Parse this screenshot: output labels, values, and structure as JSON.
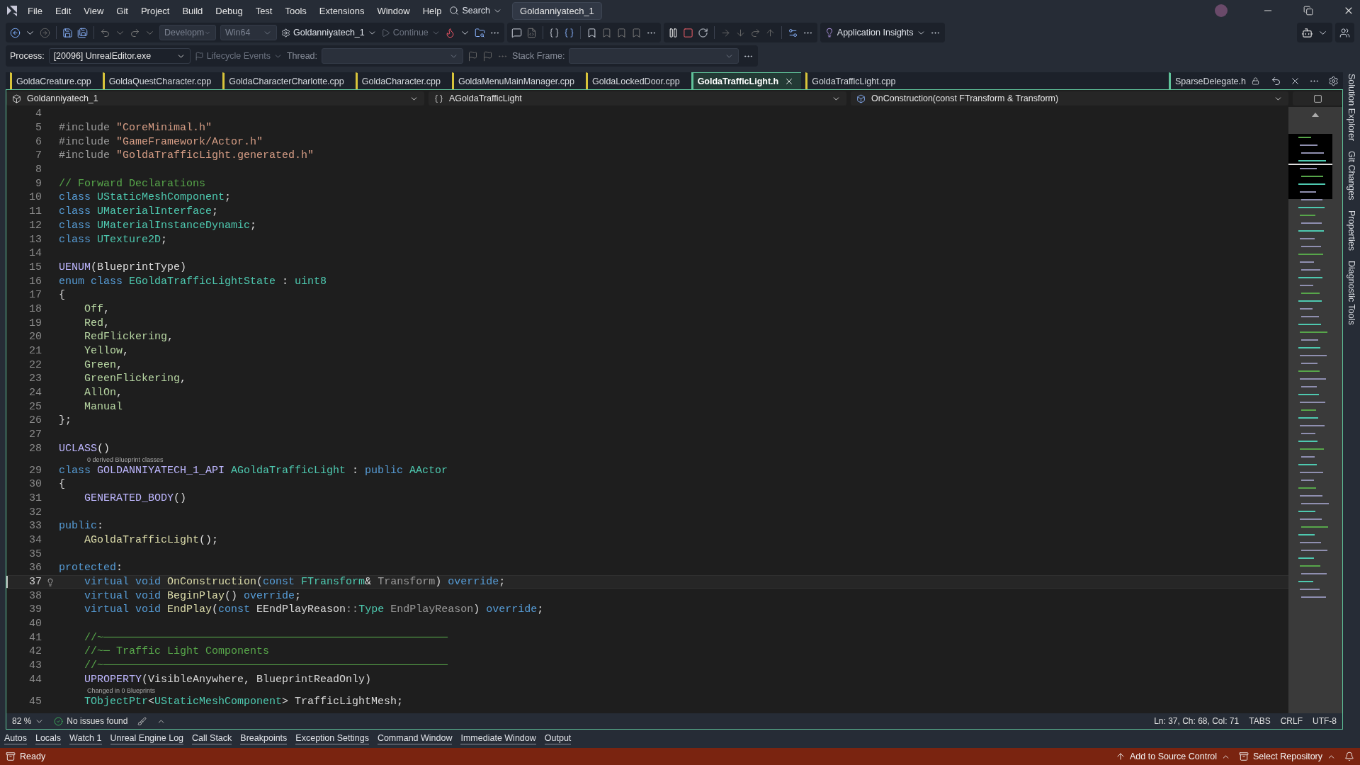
{
  "menu": [
    "File",
    "Edit",
    "View",
    "Git",
    "Project",
    "Build",
    "Debug",
    "Test",
    "Tools",
    "Extensions",
    "Window",
    "Help"
  ],
  "search": "Search",
  "solution_title": "Goldanniyatech_1",
  "toolbar": {
    "configuration": "Developm",
    "platform": "Win64",
    "startup": "Goldanniyatech_1",
    "continue": "Continue",
    "insights": "Application Insights"
  },
  "debug_bar": {
    "process_label": "Process:",
    "process": "[20096] UnrealEditor.exe",
    "lifecycle": "Lifecycle Events",
    "thread_label": "Thread:",
    "stack_label": "Stack Frame:"
  },
  "tabs": [
    {
      "label": "GoldaCreature.cpp",
      "color": "#d8c43a",
      "selected": false
    },
    {
      "label": "GoldaQuestCharacter.cpp",
      "color": "#d8c43a",
      "selected": false
    },
    {
      "label": "GoldaCharacterCharlotte.cpp",
      "color": "#d8c43a",
      "selected": false
    },
    {
      "label": "GoldaCharacter.cpp",
      "color": "#d8c43a",
      "selected": false
    },
    {
      "label": "GoldaMenuMainManager.cpp",
      "color": "#d8c43a",
      "selected": false
    },
    {
      "label": "GoldaLockedDoor.cpp",
      "color": "#d8c43a",
      "selected": false
    },
    {
      "label": "GoldaTrafficLight.h",
      "color": "#5fc39a",
      "selected": true
    },
    {
      "label": "GoldaTrafficLight.cpp",
      "color": "#d8c43a",
      "selected": false
    }
  ],
  "pinned_tab": {
    "label": "SparseDelegate.h",
    "color": "#5fc39a"
  },
  "nav": {
    "project": "Goldanniyatech_1",
    "scope": "AGoldaTrafficLight",
    "member": "OnConstruction(const FTransform & Transform)"
  },
  "lines": [
    {
      "kind": "code",
      "num": "4",
      "selected": false
    },
    {
      "kind": "code",
      "num": "5",
      "selected": false,
      "tokens": [
        {
          "text": "#include ",
          "kind": "pre"
        },
        {
          "text": "\"CoreMinimal.h\"",
          "kind": "str"
        }
      ]
    },
    {
      "kind": "code",
      "num": "6",
      "selected": false,
      "tokens": [
        {
          "text": "#include ",
          "kind": "pre"
        },
        {
          "text": "\"GameFramework/Actor.h\"",
          "kind": "str"
        }
      ]
    },
    {
      "kind": "code",
      "num": "7",
      "selected": false,
      "tokens": [
        {
          "text": "#include ",
          "kind": "pre"
        },
        {
          "text": "\"GoldaTrafficLight.generated.h\"",
          "kind": "str"
        }
      ]
    },
    {
      "kind": "code",
      "num": "8",
      "selected": false
    },
    {
      "kind": "code",
      "num": "9",
      "selected": false,
      "tokens": [
        {
          "text": "// Forward Declarations",
          "kind": "cm"
        }
      ]
    },
    {
      "kind": "code",
      "num": "10",
      "selected": false,
      "tokens": [
        {
          "text": "class ",
          "kind": "kw"
        },
        {
          "text": "UStaticMeshComponent",
          "kind": "type"
        },
        {
          "text": ";",
          "kind": "plain"
        }
      ]
    },
    {
      "kind": "code",
      "num": "11",
      "selected": false,
      "tokens": [
        {
          "text": "class ",
          "kind": "kw"
        },
        {
          "text": "UMaterialInterface",
          "kind": "type"
        },
        {
          "text": ";",
          "kind": "plain"
        }
      ]
    },
    {
      "kind": "code",
      "num": "12",
      "selected": false,
      "tokens": [
        {
          "text": "class ",
          "kind": "kw"
        },
        {
          "text": "UMaterialInstanceDynamic",
          "kind": "type"
        },
        {
          "text": ";",
          "kind": "plain"
        }
      ]
    },
    {
      "kind": "code",
      "num": "13",
      "selected": false,
      "tokens": [
        {
          "text": "class ",
          "kind": "kw"
        },
        {
          "text": "UTexture2D",
          "kind": "type"
        },
        {
          "text": ";",
          "kind": "plain"
        }
      ]
    },
    {
      "kind": "code",
      "num": "14",
      "selected": false
    },
    {
      "kind": "code",
      "num": "15",
      "selected": false,
      "tokens": [
        {
          "text": "UENUM",
          "kind": "mac"
        },
        {
          "text": "(BlueprintType)",
          "kind": "plain"
        }
      ]
    },
    {
      "kind": "code",
      "num": "16",
      "selected": false,
      "tokens": [
        {
          "text": "enum class ",
          "kind": "kw"
        },
        {
          "text": "EGoldaTrafficLightState",
          "kind": "type"
        },
        {
          "text": " : ",
          "kind": "plain"
        },
        {
          "text": "uint8",
          "kind": "type"
        }
      ]
    },
    {
      "kind": "code",
      "num": "17",
      "selected": false,
      "tokens": [
        {
          "text": "{",
          "kind": "plain"
        }
      ]
    },
    {
      "kind": "code",
      "num": "18",
      "selected": false,
      "tokens": [
        {
          "text": "    Off",
          "kind": "enum"
        },
        {
          "text": ",",
          "kind": "plain"
        }
      ]
    },
    {
      "kind": "code",
      "num": "19",
      "selected": false,
      "tokens": [
        {
          "text": "    Red",
          "kind": "enum"
        },
        {
          "text": ",",
          "kind": "plain"
        }
      ]
    },
    {
      "kind": "code",
      "num": "20",
      "selected": false,
      "tokens": [
        {
          "text": "    RedFlickering",
          "kind": "enum"
        },
        {
          "text": ",",
          "kind": "plain"
        }
      ]
    },
    {
      "kind": "code",
      "num": "21",
      "selected": false,
      "tokens": [
        {
          "text": "    Yellow",
          "kind": "enum"
        },
        {
          "text": ",",
          "kind": "plain"
        }
      ]
    },
    {
      "kind": "code",
      "num": "22",
      "selected": false,
      "tokens": [
        {
          "text": "    Green",
          "kind": "enum"
        },
        {
          "text": ",",
          "kind": "plain"
        }
      ]
    },
    {
      "kind": "code",
      "num": "23",
      "selected": false,
      "tokens": [
        {
          "text": "    GreenFlickering",
          "kind": "enum"
        },
        {
          "text": ",",
          "kind": "plain"
        }
      ]
    },
    {
      "kind": "code",
      "num": "24",
      "selected": false,
      "tokens": [
        {
          "text": "    AllOn",
          "kind": "enum"
        },
        {
          "text": ",",
          "kind": "plain"
        }
      ]
    },
    {
      "kind": "code",
      "num": "25",
      "selected": false,
      "tokens": [
        {
          "text": "    Manual",
          "kind": "enum"
        }
      ]
    },
    {
      "kind": "code",
      "num": "26",
      "selected": false,
      "tokens": [
        {
          "text": "};",
          "kind": "plain"
        }
      ]
    },
    {
      "kind": "code",
      "num": "27",
      "selected": false
    },
    {
      "kind": "code",
      "num": "28",
      "selected": false,
      "tokens": [
        {
          "text": "UCLASS",
          "kind": "mac"
        },
        {
          "text": "()",
          "kind": "plain"
        }
      ]
    },
    {
      "kind": "lens",
      "text": "0 derived Blueprint classes"
    },
    {
      "kind": "code",
      "num": "29",
      "selected": false,
      "tokens": [
        {
          "text": "class ",
          "kind": "kw"
        },
        {
          "text": "GOLDANNIYATECH_1_API ",
          "kind": "mac"
        },
        {
          "text": "AGoldaTrafficLight",
          "kind": "type"
        },
        {
          "text": " : ",
          "kind": "plain"
        },
        {
          "text": "public ",
          "kind": "kw"
        },
        {
          "text": "AActor",
          "kind": "type"
        }
      ]
    },
    {
      "kind": "code",
      "num": "30",
      "selected": false,
      "tokens": [
        {
          "text": "{",
          "kind": "plain"
        }
      ]
    },
    {
      "kind": "code",
      "num": "31",
      "selected": false,
      "tokens": [
        {
          "text": "    GENERATED_BODY",
          "kind": "mac"
        },
        {
          "text": "()",
          "kind": "plain"
        }
      ]
    },
    {
      "kind": "code",
      "num": "32",
      "selected": false
    },
    {
      "kind": "code",
      "num": "33",
      "selected": false,
      "tokens": [
        {
          "text": "public",
          "kind": "kw"
        },
        {
          "text": ":",
          "kind": "plain"
        }
      ]
    },
    {
      "kind": "code",
      "num": "34",
      "selected": false,
      "tokens": [
        {
          "text": "    AGoldaTrafficLight",
          "kind": "fn"
        },
        {
          "text": "();",
          "kind": "plain"
        }
      ]
    },
    {
      "kind": "code",
      "num": "35",
      "selected": false
    },
    {
      "kind": "code",
      "num": "36",
      "selected": false,
      "tokens": [
        {
          "text": "protected",
          "kind": "kw"
        },
        {
          "text": ":",
          "kind": "plain"
        }
      ]
    },
    {
      "kind": "code",
      "num": "37",
      "selected": true,
      "tokens": [
        {
          "text": "    virtual void ",
          "kind": "kw"
        },
        {
          "text": "OnConstruction",
          "kind": "fn"
        },
        {
          "text": "(",
          "kind": "plain"
        },
        {
          "text": "const ",
          "kind": "kw"
        },
        {
          "text": "FTransform",
          "kind": "type"
        },
        {
          "text": "& ",
          "kind": "plain"
        },
        {
          "text": "Transform",
          "kind": "param"
        },
        {
          "text": ") ",
          "kind": "plain"
        },
        {
          "text": "override",
          "kind": "kw"
        },
        {
          "text": ";",
          "kind": "plain"
        }
      ]
    },
    {
      "kind": "code",
      "num": "38",
      "selected": false,
      "tokens": [
        {
          "text": "    virtual void ",
          "kind": "kw"
        },
        {
          "text": "BeginPlay",
          "kind": "fn"
        },
        {
          "text": "() ",
          "kind": "plain"
        },
        {
          "text": "override",
          "kind": "kw"
        },
        {
          "text": ";",
          "kind": "plain"
        }
      ]
    },
    {
      "kind": "code",
      "num": "39",
      "selected": false,
      "tokens": [
        {
          "text": "    virtual void ",
          "kind": "kw"
        },
        {
          "text": "EndPlay",
          "kind": "fn"
        },
        {
          "text": "(",
          "kind": "plain"
        },
        {
          "text": "const ",
          "kind": "kw"
        },
        {
          "text": "EEndPlayReason",
          "kind": "plain"
        },
        {
          "text": "::",
          "kind": "param"
        },
        {
          "text": "Type ",
          "kind": "type"
        },
        {
          "text": "EndPlayReason",
          "kind": "param"
        },
        {
          "text": ") ",
          "kind": "plain"
        },
        {
          "text": "override",
          "kind": "kw"
        },
        {
          "text": ";",
          "kind": "plain"
        }
      ]
    },
    {
      "kind": "code",
      "num": "40",
      "selected": false
    },
    {
      "kind": "code",
      "num": "41",
      "selected": false,
      "tokens": [
        {
          "text": "    //~──────────────────────────────────────────────────────",
          "kind": "cm"
        }
      ]
    },
    {
      "kind": "code",
      "num": "42",
      "selected": false,
      "tokens": [
        {
          "text": "    //~─ Traffic Light Components",
          "kind": "cm"
        }
      ]
    },
    {
      "kind": "code",
      "num": "43",
      "selected": false,
      "tokens": [
        {
          "text": "    //~──────────────────────────────────────────────────────",
          "kind": "cm"
        }
      ]
    },
    {
      "kind": "code",
      "num": "44",
      "selected": false,
      "tokens": [
        {
          "text": "    UPROPERTY",
          "kind": "mac"
        },
        {
          "text": "(VisibleAnywhere, BlueprintReadOnly)",
          "kind": "plain"
        }
      ]
    },
    {
      "kind": "lens",
      "text": "Changed in 0 Blueprints"
    },
    {
      "kind": "code",
      "num": "45",
      "selected": false,
      "tokens": [
        {
          "text": "    TObjectPtr",
          "kind": "type"
        },
        {
          "text": "<",
          "kind": "plain"
        },
        {
          "text": "UStaticMeshComponent",
          "kind": "type"
        },
        {
          "text": "> TrafficLightMesh;",
          "kind": "plain"
        }
      ]
    }
  ],
  "side_tabs": [
    "Solution Explorer",
    "Git Changes",
    "Properties",
    "Diagnostic Tools"
  ],
  "editor_status": {
    "zoom": "82 %",
    "issues": "No issues found",
    "position": "Ln: 37, Ch: 68, Col: 71",
    "indent": "TABS",
    "line_ending": "CRLF",
    "encoding": "UTF-8"
  },
  "tool_tabs": [
    "Autos",
    "Locals",
    "Watch 1",
    "Unreal Engine Log",
    "Call Stack",
    "Breakpoints",
    "Exception Settings",
    "Command Window",
    "Immediate Window",
    "Output"
  ],
  "status_bar": {
    "state": "Ready",
    "source_control": "Add to Source Control",
    "repository": "Select Repository"
  }
}
